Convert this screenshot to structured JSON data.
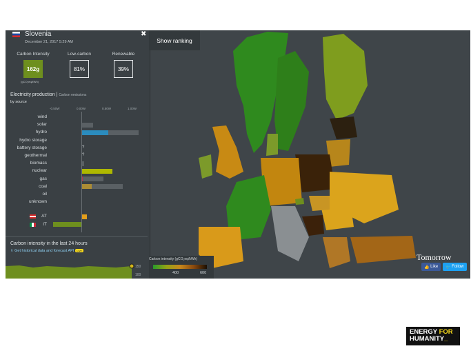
{
  "zone": {
    "name": "Slovenia",
    "date": "December 21, 2017 5:29 AM"
  },
  "kpis": {
    "carbon_label": "Carbon Intensity",
    "carbon_value": "162g",
    "carbon_unit": "(gCO₂eq/kWh)",
    "carbon_color": "#6e8f1e",
    "lowcarbon_label": "Low-carbon",
    "lowcarbon_value": "81%",
    "renewable_label": "Renewable",
    "renewable_value": "39%"
  },
  "production": {
    "title": "Electricity production",
    "toggle": "Carbon emissions",
    "subtitle": "by source",
    "axis": [
      "-0.50W",
      "0.00W",
      "0.50W",
      "1.00W"
    ],
    "sources": [
      {
        "label": "wind",
        "value": 0,
        "capacity": 0,
        "color": "#74cdb9"
      },
      {
        "label": "solar",
        "value": 0,
        "capacity": 0.23,
        "color": "#f27406"
      },
      {
        "label": "hydro",
        "value": 0.52,
        "capacity": 1.1,
        "color": "#2b8cbe"
      },
      {
        "label": "hydro storage",
        "value": 0,
        "capacity": 0,
        "color": "#0052cc"
      },
      {
        "label": "battery storage",
        "value": null,
        "capacity": 0,
        "color": "#b6b6b6"
      },
      {
        "label": "geothermal",
        "value": null,
        "capacity": 0,
        "color": "#e3690c"
      },
      {
        "label": "biomass",
        "value": 0.01,
        "capacity": 0.05,
        "color": "#166a57"
      },
      {
        "label": "nuclear",
        "value": 0.6,
        "capacity": 0.6,
        "color": "#aeb800"
      },
      {
        "label": "gas",
        "value": 0.02,
        "capacity": 0.43,
        "color": "#bb2f51"
      },
      {
        "label": "coal",
        "value": 0.2,
        "capacity": 0.8,
        "color": "#ac8c35"
      },
      {
        "label": "oil",
        "value": 0,
        "capacity": 0,
        "color": "#867d66"
      },
      {
        "label": "unknown",
        "value": 0,
        "capacity": 0,
        "color": "#acacac"
      }
    ],
    "exchanges": [
      {
        "label": "AT",
        "value": 0.1,
        "color": "#e49f1c"
      },
      {
        "label": "IT",
        "value": -0.55,
        "color": "#6e8f1e"
      }
    ]
  },
  "history": {
    "title": "Carbon intensity in the last 24 hours",
    "link": "Get historical data and forecast API",
    "badge": "Live",
    "ticks": [
      "200",
      "150",
      "100"
    ]
  },
  "map": {
    "show_ranking": "Show ranking",
    "legend_title": "Carbon intensity (gCO₂eq/kWh)",
    "legend_ticks": [
      "400",
      "600"
    ],
    "brand": "Tomorrow",
    "like": "Like",
    "follow": "Follow"
  },
  "logo": {
    "line1a": "ENERGY",
    "line1b": "FOR",
    "line2": "HUMANITY"
  }
}
